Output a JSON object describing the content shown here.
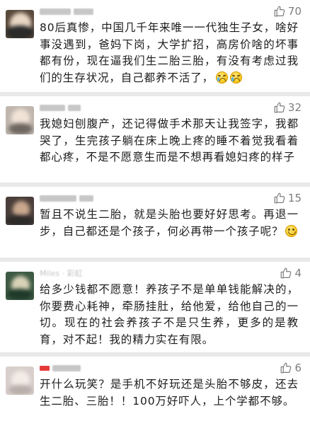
{
  "comments": [
    {
      "like_count": "70",
      "text": "80后真惨，中国几千年来唯一一代独生子女，啥好事没遇到，爸妈下岗，大学扩招，高房价啥的坏事都有份，现在逼我们生二胎三胎，有没有考虑过我们的生存状况，自己都养不活了，",
      "emojis": [
        "crying-face-emoji",
        "crying-face-emoji"
      ]
    },
    {
      "like_count": "32",
      "text": "我媳妇刨腹产，还记得做手术那天让我签字，我都哭了，生完孩子躺在床上晚上疼的睡不着觉我看着都心疼，不是不愿意生而是不想再看媳妇疼的样子"
    },
    {
      "like_count": "15",
      "text": "暂且不说生二胎，就是头胎也要好好思考。再退一步，自己都还是个孩子，何必再带一个孩子呢？",
      "emojis": [
        "smiling-face-emoji"
      ]
    },
    {
      "like_count": "4",
      "username": "Miles · 彩虹",
      "text": "给多少钱都不愿意！养孩子不是单单钱能解决的，你要费心耗神，牵肠挂肚，给他爱，给他自己的一切。现在的社会养孩子不是只生养，更多的是教育，对不起！我的精力实在有限。"
    },
    {
      "like_count": "6",
      "text": "开什么玩笑？是手机不好玩还是头胎不够皮，还去生二胎、三胎！！100万好吓人，上个学都不够。"
    }
  ],
  "colors": {
    "background": "#e9e9e9",
    "card": "#ffffff",
    "text": "#1c1c1c",
    "like": "#7d7d7d",
    "username_redacted": "#c7c7c7"
  }
}
